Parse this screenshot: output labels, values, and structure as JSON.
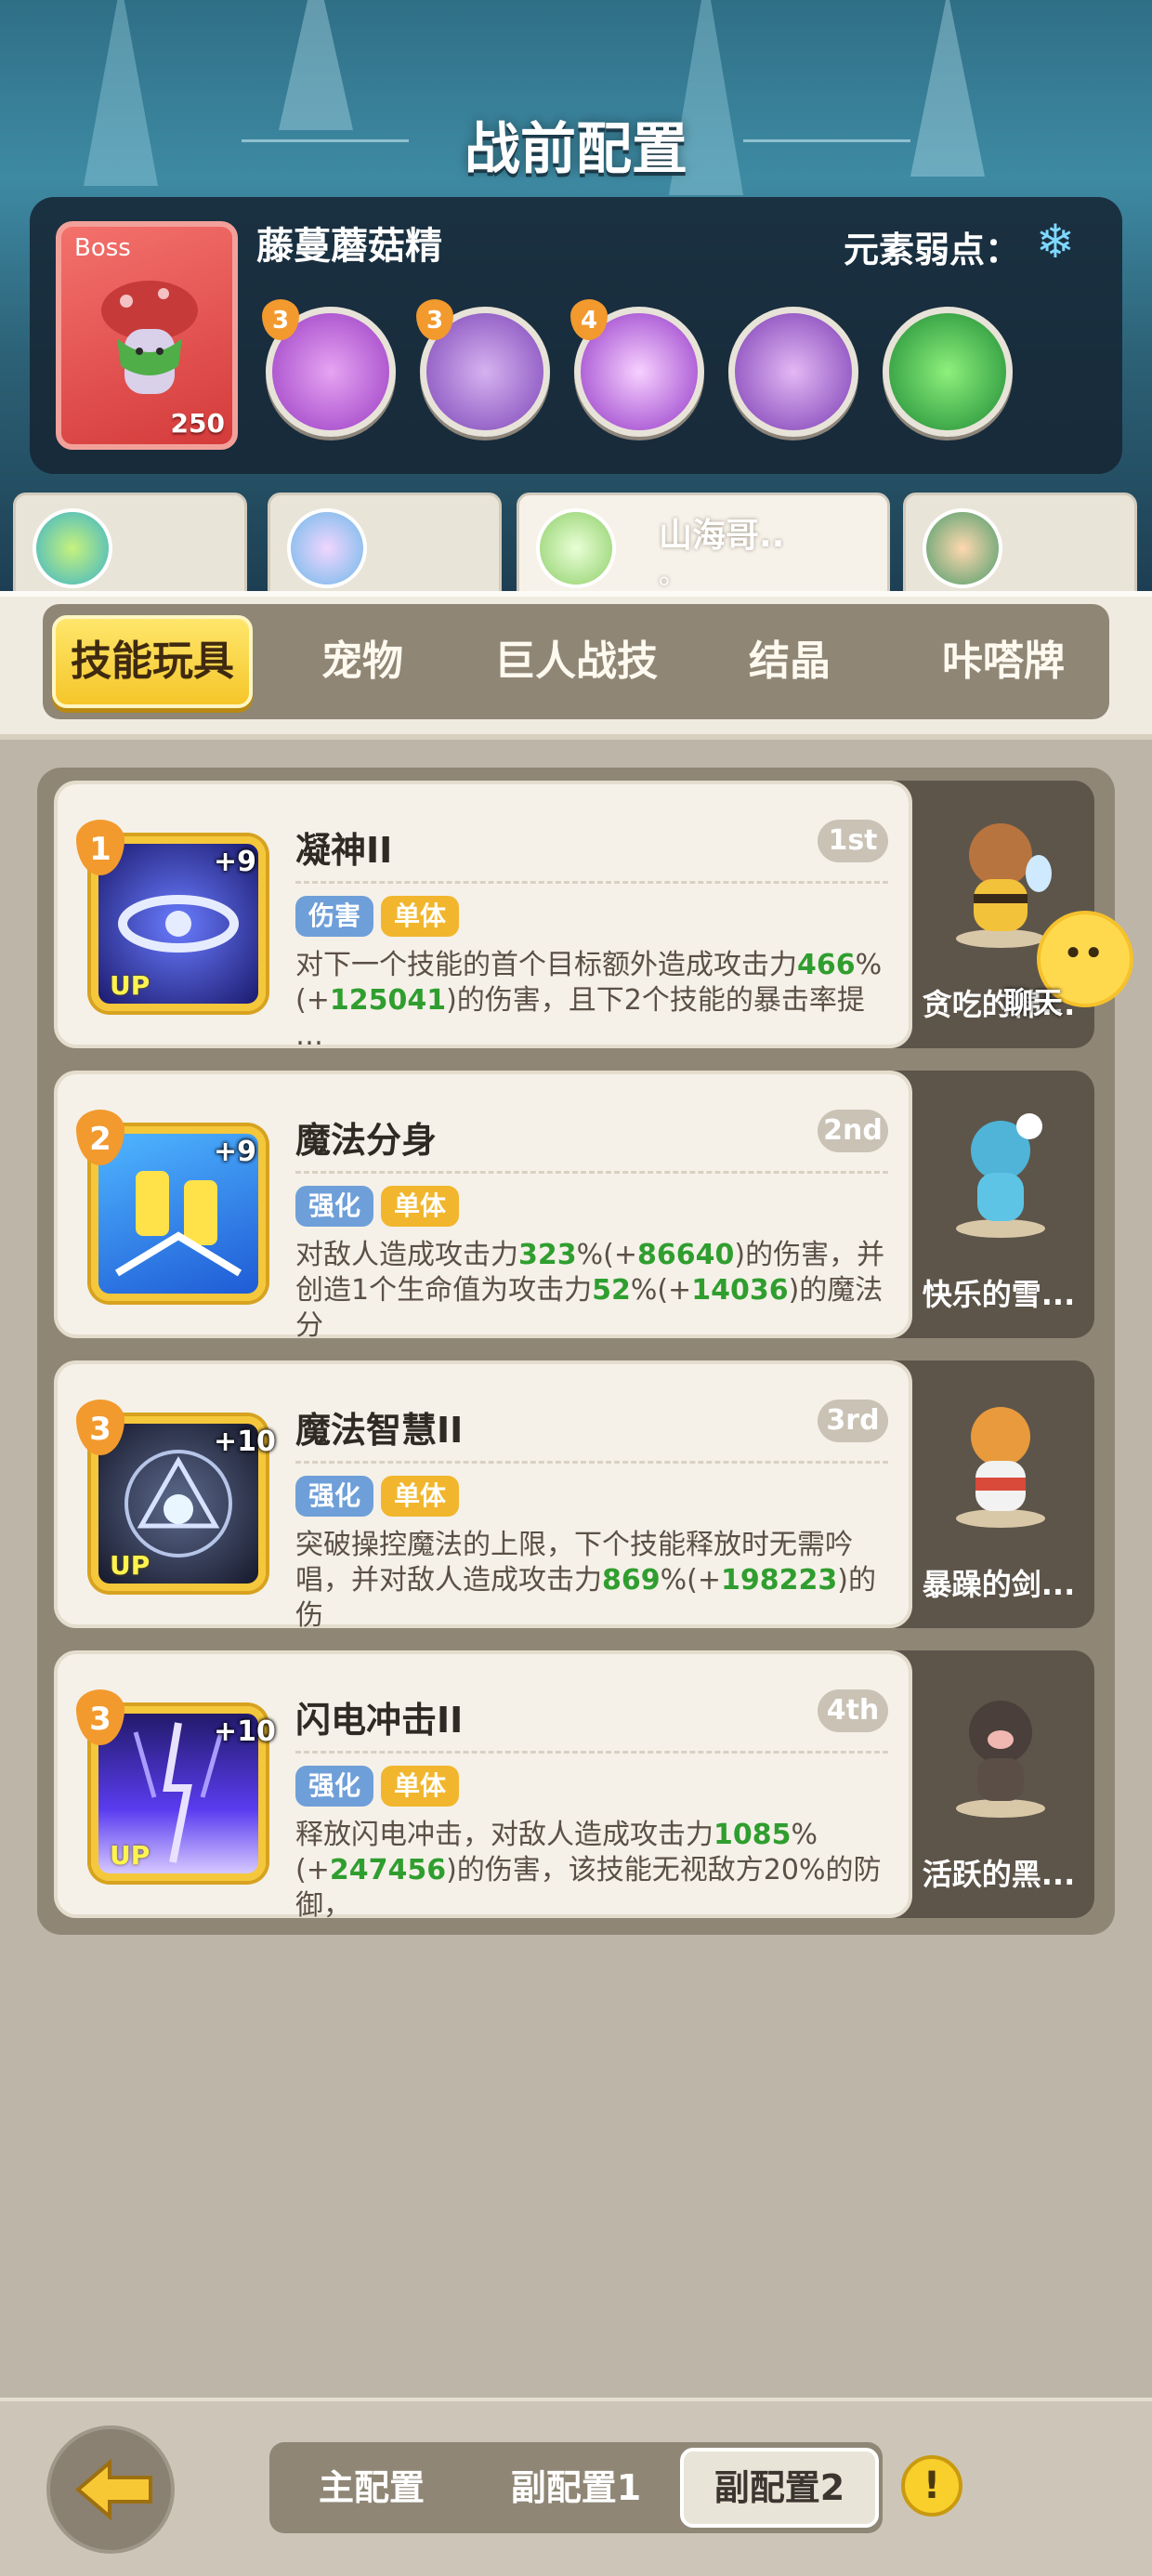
{
  "title": "战前配置",
  "boss": {
    "tag": "Boss",
    "level": "250",
    "name": "藤蔓蘑菇精",
    "weakness_label": "元素弱点：",
    "weakness_icon": "snowflake-icon",
    "skills": [
      {
        "badge": "3",
        "icon": "purple-swirl-icon",
        "color": "#b04ad6"
      },
      {
        "badge": "3",
        "icon": "purple-mushroom-drip-icon",
        "color": "#9c5ad0"
      },
      {
        "badge": "4",
        "icon": "glowing-mushroom-icon",
        "color": "#a446d0"
      },
      {
        "badge": "",
        "icon": "mushroom-icon",
        "color": "#8c4bc6"
      },
      {
        "badge": "",
        "icon": "green-slime-icon",
        "color": "#2fb04a"
      }
    ]
  },
  "team": [
    {
      "name": "",
      "sub": ""
    },
    {
      "name": "",
      "sub": ""
    },
    {
      "name": "山海哥..",
      "sub": "。"
    },
    {
      "name": "",
      "sub": ""
    }
  ],
  "tabs": [
    "技能玩具",
    "宠物",
    "巨人战技",
    "结晶",
    "咔嗒牌"
  ],
  "active_tab": "技能玩具",
  "skills": [
    {
      "order": "1",
      "level": "+9",
      "up": "UP",
      "name": "凝神II",
      "rank": "1st",
      "tag1": "伤害",
      "tag2": "单体",
      "d1": "对下一个技能的首个目标额外造成攻击力",
      "g1": "466",
      "d2": "%(+",
      "g2": "125041",
      "d3": ")的伤害，且下2个技能的暴击率提",
      "d4": "…",
      "pet": "贪吃的棉..."
    },
    {
      "order": "2",
      "level": "+9",
      "up": "",
      "name": "魔法分身",
      "rank": "2nd",
      "tag1": "强化",
      "tag2": "单体",
      "d1": "对敌人造成攻击力",
      "g1": "323",
      "d2": "%(+",
      "g2": "86640",
      "d3": ")的伤害，并创造1个生命值为攻击力",
      "g3": "52",
      "d4": "%(+",
      "g4": "14036",
      "d5": ")的魔法分",
      "d6": "…",
      "pet": "快乐的雪..."
    },
    {
      "order": "3",
      "level": "+10",
      "up": "UP",
      "name": "魔法智慧II",
      "rank": "3rd",
      "tag1": "强化",
      "tag2": "单体",
      "d1": "突破操控魔法的上限，下个技能释放时无需吟唱，并对敌人造成攻击力",
      "g1": "869",
      "d2": "%(+",
      "g2": "198223",
      "d3": ")的伤",
      "d4": "…",
      "pet": "暴躁的剑..."
    },
    {
      "order": "3",
      "level": "+10",
      "up": "UP",
      "name": "闪电冲击II",
      "rank": "4th",
      "tag1": "强化",
      "tag2": "单体",
      "d1": "释放闪电冲击，对敌人造成攻击力",
      "g1": "1085",
      "d2": "%(+",
      "g2": "247456",
      "d3": ")的伤害，该技能无视敌方20%的防御，",
      "d4": "…",
      "pet": "活跃的黑..."
    }
  ],
  "chat_label": "聊天",
  "configs": [
    "主配置",
    "副配置1",
    "副配置2"
  ],
  "active_config": "副配置2",
  "info_label": "!"
}
